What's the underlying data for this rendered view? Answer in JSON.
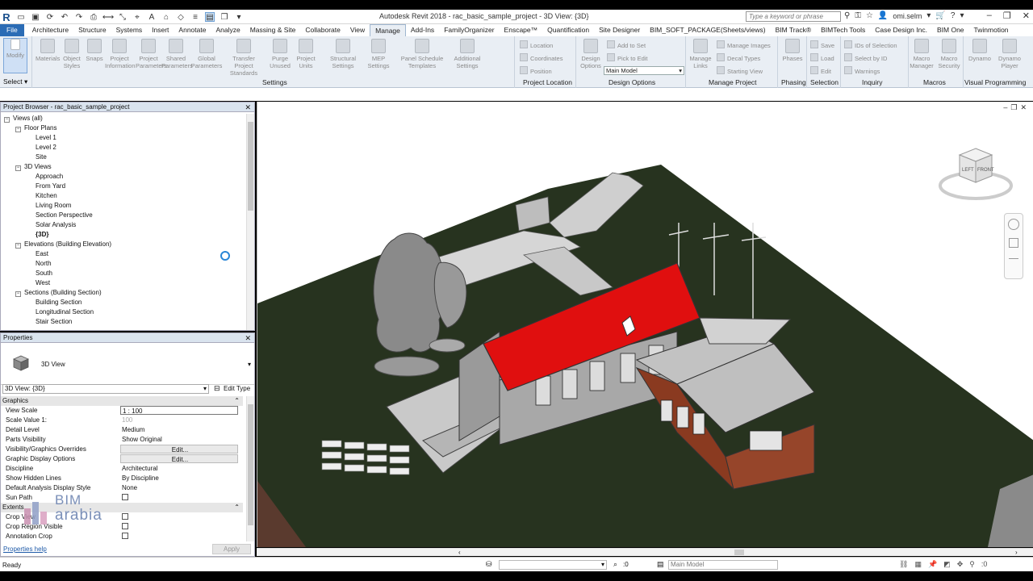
{
  "titlebar": {
    "title": "Autodesk Revit 2018 -     rac_basic_sample_project - 3D View: {3D}",
    "search_placeholder": "Type a keyword or phrase",
    "user": "omi.selm"
  },
  "tabs": [
    "File",
    "Architecture",
    "Structure",
    "Systems",
    "Insert",
    "Annotate",
    "Analyze",
    "Massing & Site",
    "Collaborate",
    "View",
    "Manage",
    "Add-Ins",
    "FamilyOrganizer",
    "Enscape™",
    "Quantification",
    "Site Designer",
    "BIM_SOFT_PACKAGE(Sheets/views)",
    "BIM Track®",
    "BIMTech Tools",
    "Case Design Inc.",
    "BIM One",
    "Twinmotion"
  ],
  "active_tab": "Manage",
  "ribbon": {
    "select_label": "Select",
    "modify_label": "Modify",
    "settings_buttons": [
      "Materials",
      "Object Styles",
      "Snaps",
      "Project Information",
      "Project Parameters",
      "Shared Parameters",
      "Global Parameters",
      "Transfer Project Standards",
      "Purge Unused",
      "Project Units",
      "Structural Settings",
      "MEP Settings",
      "Panel Schedule Templates",
      "Additional Settings"
    ],
    "settings_label": "Settings",
    "project_location": {
      "items": [
        "Location",
        "Coordinates",
        "Position"
      ],
      "label": "Project Location"
    },
    "design_options": {
      "button": "Design Options",
      "items": [
        "Add to Set",
        "Pick to Edit"
      ],
      "dropdown": "Main Model",
      "label": "Design Options"
    },
    "manage_project": {
      "button": "Manage Links",
      "items": [
        "Manage Images",
        "Decal Types",
        "Starting View"
      ],
      "label": "Manage Project"
    },
    "phasing": {
      "button": "Phases",
      "label": "Phasing"
    },
    "selection": {
      "items": [
        "Save",
        "Load",
        "Edit"
      ],
      "label": "Selection"
    },
    "inquiry": {
      "items": [
        "IDs of Selection",
        "Select by ID",
        "Warnings"
      ],
      "label": "Inquiry"
    },
    "macros": {
      "buttons": [
        "Macro Manager",
        "Macro Security"
      ],
      "label": "Macros"
    },
    "visual_programming": {
      "buttons": [
        "Dynamo",
        "Dynamo Player"
      ],
      "label": "Visual Programming"
    }
  },
  "project_browser": {
    "title": "Project Browser - rac_basic_sample_project",
    "tree": [
      {
        "label": "Views (all)",
        "level": 0,
        "toggle": "−"
      },
      {
        "label": "Floor Plans",
        "level": 1,
        "toggle": "−"
      },
      {
        "label": "Level 1",
        "level": 2
      },
      {
        "label": "Level 2",
        "level": 2
      },
      {
        "label": "Site",
        "level": 2
      },
      {
        "label": "3D Views",
        "level": 1,
        "toggle": "−"
      },
      {
        "label": "Approach",
        "level": 2
      },
      {
        "label": "From Yard",
        "level": 2
      },
      {
        "label": "Kitchen",
        "level": 2
      },
      {
        "label": "Living Room",
        "level": 2
      },
      {
        "label": "Section Perspective",
        "level": 2
      },
      {
        "label": "Solar Analysis",
        "level": 2
      },
      {
        "label": "{3D}",
        "level": 2,
        "bold": true
      },
      {
        "label": "Elevations (Building Elevation)",
        "level": 1,
        "toggle": "−"
      },
      {
        "label": "East",
        "level": 2
      },
      {
        "label": "North",
        "level": 2
      },
      {
        "label": "South",
        "level": 2
      },
      {
        "label": "West",
        "level": 2
      },
      {
        "label": "Sections (Building Section)",
        "level": 1,
        "toggle": "−"
      },
      {
        "label": "Building Section",
        "level": 2
      },
      {
        "label": "Longitudinal Section",
        "level": 2
      },
      {
        "label": "Stair Section",
        "level": 2
      }
    ]
  },
  "properties": {
    "title": "Properties",
    "type_name": "3D View",
    "instance_selector": "3D View: {3D}",
    "edit_type": "Edit Type",
    "rows": [
      {
        "kind": "section",
        "key": "Graphics"
      },
      {
        "key": "View Scale",
        "value": "1 : 100",
        "style": "box"
      },
      {
        "key": "Scale Value   1:",
        "value": "100",
        "style": "dim"
      },
      {
        "key": "Detail Level",
        "value": "Medium"
      },
      {
        "key": "Parts Visibility",
        "value": "Show Original"
      },
      {
        "key": "Visibility/Graphics Overrides",
        "value": "Edit...",
        "style": "btn"
      },
      {
        "key": "Graphic Display Options",
        "value": "Edit...",
        "style": "btn"
      },
      {
        "key": "Discipline",
        "value": "Architectural"
      },
      {
        "key": "Show Hidden Lines",
        "value": "By Discipline"
      },
      {
        "key": "Default Analysis Display Style",
        "value": "None"
      },
      {
        "key": "Sun Path",
        "value": "",
        "style": "check"
      },
      {
        "kind": "section",
        "key": "Extents"
      },
      {
        "key": "Crop View",
        "value": "",
        "style": "check"
      },
      {
        "key": "Crop Region Visible",
        "value": "",
        "style": "check"
      },
      {
        "key": "Annotation Crop",
        "value": "",
        "style": "check"
      }
    ],
    "help_link": "Properties help",
    "apply": "Apply"
  },
  "watermark": {
    "line1": "BIM",
    "line2": "arabia"
  },
  "viewcube": {
    "left": "LEFT",
    "front": "FRONT"
  },
  "statusbar": {
    "text": "Ready",
    "zero": ":0",
    "model": "Main Model"
  }
}
